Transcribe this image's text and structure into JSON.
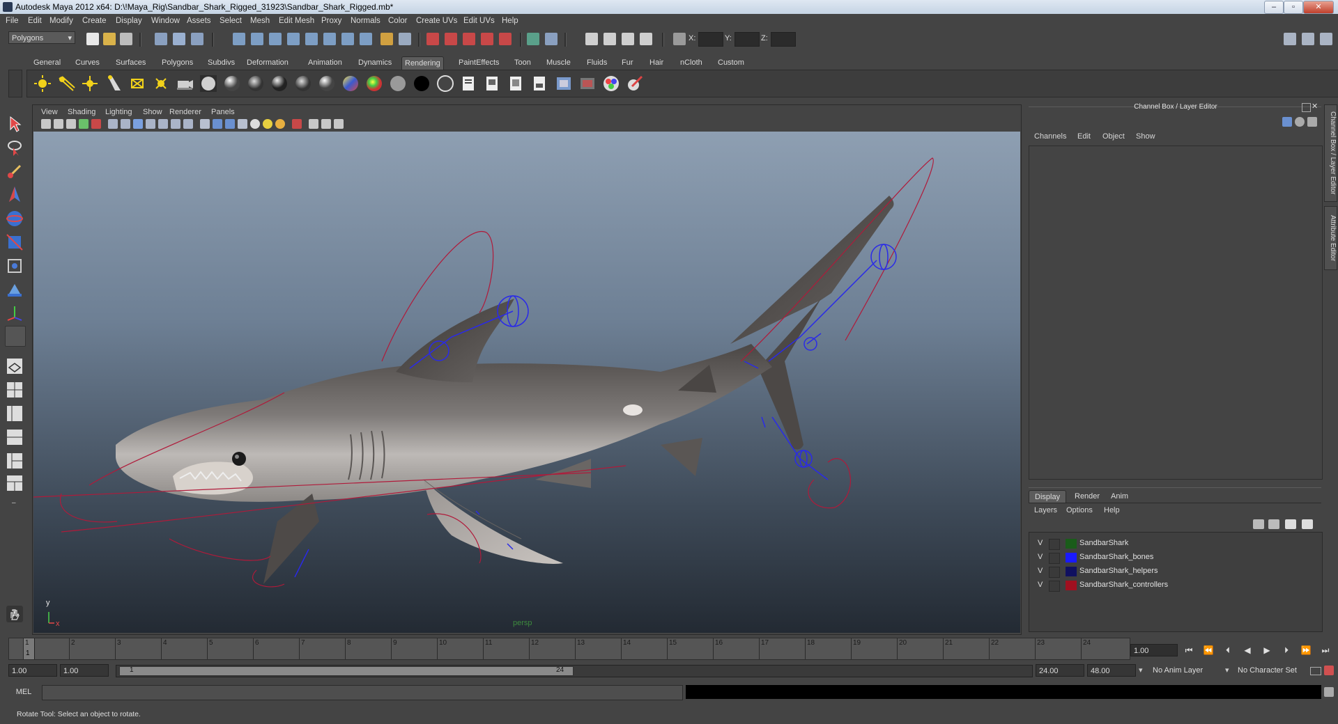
{
  "window": {
    "title": "Autodesk Maya 2012 x64: D:\\!Maya_Rig\\Sandbar_Shark_Rigged_31923\\Sandbar_Shark_Rigged.mb*"
  },
  "menubar": [
    "File",
    "Edit",
    "Modify",
    "Create",
    "Display",
    "Window",
    "Assets",
    "Select",
    "Mesh",
    "Edit Mesh",
    "Proxy",
    "Normals",
    "Color",
    "Create UVs",
    "Edit UVs",
    "Help"
  ],
  "statusline": {
    "mode": "Polygons",
    "x_label": "X:",
    "y_label": "Y:",
    "z_label": "Z:"
  },
  "shelf": {
    "tabs": [
      "General",
      "Curves",
      "Surfaces",
      "Polygons",
      "Subdivs",
      "Deformation",
      "Animation",
      "Dynamics",
      "Rendering",
      "PaintEffects",
      "Toon",
      "Muscle",
      "Fluids",
      "Fur",
      "Hair",
      "nCloth",
      "Custom"
    ],
    "active": "Rendering"
  },
  "viewport": {
    "menus": [
      "View",
      "Shading",
      "Lighting",
      "Show",
      "Renderer",
      "Panels"
    ],
    "camera": "persp",
    "axis_y": "y",
    "axis_x": "x"
  },
  "channelbox": {
    "title": "Channel Box / Layer Editor",
    "menus": [
      "Channels",
      "Edit",
      "Object",
      "Show"
    ]
  },
  "sidetabs": [
    "Channel Box / Layer Editor",
    "Attribute Editor"
  ],
  "layers": {
    "tabs": [
      "Display",
      "Render",
      "Anim"
    ],
    "active": "Display",
    "menus": [
      "Layers",
      "Options",
      "Help"
    ],
    "items": [
      {
        "visible": "V",
        "name": "SandbarShark",
        "color": "#1a5c1a"
      },
      {
        "visible": "V",
        "name": "SandbarShark_bones",
        "color": "#1a1aff"
      },
      {
        "visible": "V",
        "name": "SandbarShark_helpers",
        "color": "#101060"
      },
      {
        "visible": "V",
        "name": "SandbarShark_controllers",
        "color": "#a01020"
      }
    ]
  },
  "timeslider": {
    "ticks": [
      "1",
      "2",
      "3",
      "4",
      "5",
      "6",
      "7",
      "8",
      "9",
      "10",
      "11",
      "12",
      "13",
      "14",
      "15",
      "16",
      "17",
      "18",
      "19",
      "20",
      "21",
      "22",
      "23",
      "24"
    ],
    "current_frame": "1",
    "current_time": "1.00"
  },
  "rangeslider": {
    "start": "1.00",
    "playback_start": "1.00",
    "range_in": "1",
    "range_out": "24",
    "playback_end": "24.00",
    "end": "48.00",
    "anim_layer": "No Anim Layer",
    "char_set": "No Character Set"
  },
  "cmdline": {
    "label": "MEL"
  },
  "helpline": {
    "text": "Rotate Tool: Select an object to rotate."
  }
}
